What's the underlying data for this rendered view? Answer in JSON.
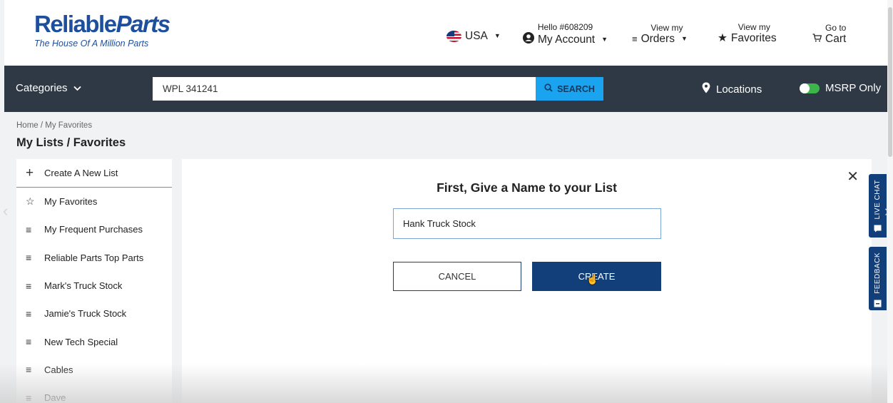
{
  "header": {
    "logo_main_a": "Reliable",
    "logo_main_b": "Parts",
    "logo_tagline": "The House Of A Million Parts",
    "country": "USA",
    "account_greeting": "Hello #608209",
    "account_label": "My Account",
    "orders_small": "View my",
    "orders_label": "Orders",
    "favorites_small": "View my",
    "favorites_label": "Favorites",
    "cart_small": "Go to",
    "cart_label": "Cart"
  },
  "navbar": {
    "categories_label": "Categories",
    "search_value": "WPL 341241",
    "search_button": "SEARCH",
    "locations_label": "Locations",
    "msrp_label": "MSRP Only"
  },
  "breadcrumb": "Home / My Favorites",
  "page_title": "My Lists / Favorites",
  "sidebar": {
    "create_label": "Create A New List",
    "items": [
      {
        "label": "My Favorites",
        "icon": "star-icon"
      },
      {
        "label": "My Frequent Purchases",
        "icon": "list-icon"
      },
      {
        "label": "Reliable Parts Top Parts",
        "icon": "list-icon"
      },
      {
        "label": "Mark's Truck Stock",
        "icon": "list-icon"
      },
      {
        "label": "Jamie's Truck Stock",
        "icon": "list-icon"
      },
      {
        "label": "New Tech Special",
        "icon": "list-icon"
      },
      {
        "label": "Cables",
        "icon": "list-icon"
      },
      {
        "label": "Dave",
        "icon": "list-icon"
      }
    ]
  },
  "modal": {
    "title": "First, Give a Name to your List",
    "list_name_value": "Hank Truck Stock",
    "cancel_label": "CANCEL",
    "create_label": "CREATE"
  },
  "side_tabs": {
    "live_chat": "LIVE CHAT",
    "feedback": "FEEDBACK"
  },
  "colors": {
    "brand_blue": "#1d4f9c",
    "navbar_bg": "#2f3845",
    "search_btn": "#1aa3ee",
    "primary_btn": "#123f7a",
    "toggle_on": "#3cb64a"
  }
}
